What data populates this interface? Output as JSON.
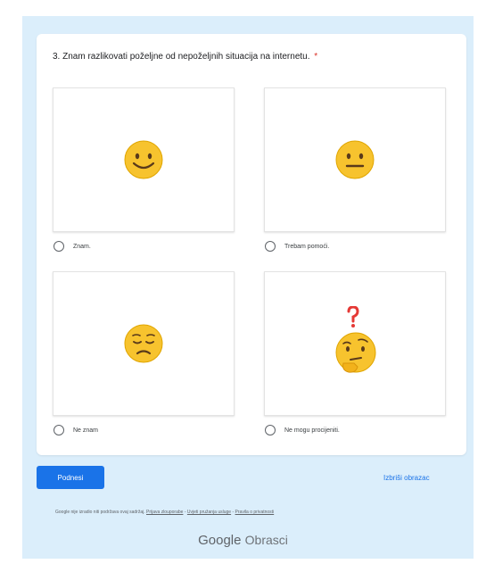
{
  "question": {
    "text": "3. Znam razlikovati poželjne od nepoželjnih situacija na internetu.",
    "required_mark": "*"
  },
  "options": [
    {
      "label": "Znam.",
      "icon": "smiling-face-icon"
    },
    {
      "label": "Trebam pomoći.",
      "icon": "neutral-face-icon"
    },
    {
      "label": "Ne znam",
      "icon": "sad-face-icon"
    },
    {
      "label": "Ne mogu procijeniti.",
      "icon": "thinking-face-icon"
    }
  ],
  "actions": {
    "submit_label": "Podnesi",
    "clear_label": "Izbriši obrazac"
  },
  "footer": {
    "notice": "Google nije izradio niti podržava ovaj sadržaj.",
    "links": [
      "Prijava zlouporabe",
      "Uvjeti pružanja usluge",
      "Pravila o privatnosti"
    ]
  },
  "brand": {
    "google": "Google",
    "product": "Obrasci"
  },
  "colors": {
    "page_background": "#dbeefb",
    "accent": "#1a73e8",
    "emoji_yellow": "#f7c32e",
    "required": "#d93025"
  }
}
